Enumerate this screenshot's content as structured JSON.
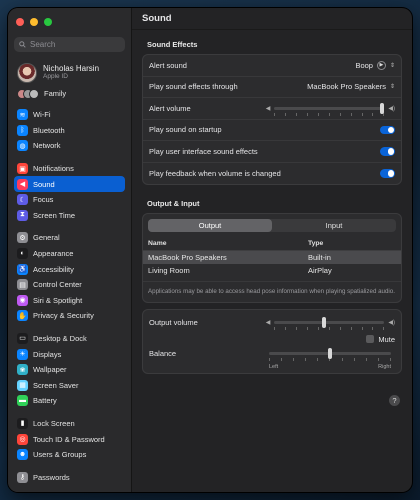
{
  "title": "Sound",
  "search": {
    "placeholder": "Search"
  },
  "account": {
    "name": "Nicholas Harsin",
    "sub": "Apple ID"
  },
  "family": {
    "label": "Family"
  },
  "sidebar": {
    "groups": [
      [
        {
          "label": "Wi-Fi",
          "icon": "wifi-icon",
          "color": "#0a84ff",
          "glyph": "≋"
        },
        {
          "label": "Bluetooth",
          "icon": "bluetooth-icon",
          "color": "#0a84ff",
          "glyph": "ᛒ"
        },
        {
          "label": "Network",
          "icon": "globe-icon",
          "color": "#0a84ff",
          "glyph": "◍"
        }
      ],
      [
        {
          "label": "Notifications",
          "icon": "bell-icon",
          "color": "#ff453a",
          "glyph": "▣"
        },
        {
          "label": "Sound",
          "icon": "speaker-icon",
          "color": "#ff3b5c",
          "glyph": "◀",
          "active": true
        },
        {
          "label": "Focus",
          "icon": "moon-icon",
          "color": "#5e5ce6",
          "glyph": "☾"
        },
        {
          "label": "Screen Time",
          "icon": "hourglass-icon",
          "color": "#5e5ce6",
          "glyph": "⧗"
        }
      ],
      [
        {
          "label": "General",
          "icon": "gear-icon",
          "color": "#8e8e93",
          "glyph": "⚙"
        },
        {
          "label": "Appearance",
          "icon": "appearance-icon",
          "color": "#1c1c1e",
          "glyph": "◐"
        },
        {
          "label": "Accessibility",
          "icon": "accessibility-icon",
          "color": "#0a84ff",
          "glyph": "♿"
        },
        {
          "label": "Control Center",
          "icon": "control-center-icon",
          "color": "#8e8e93",
          "glyph": "▤"
        },
        {
          "label": "Siri & Spotlight",
          "icon": "siri-icon",
          "color": "#bf5af2",
          "glyph": "◉"
        },
        {
          "label": "Privacy & Security",
          "icon": "hand-icon",
          "color": "#0a84ff",
          "glyph": "✋"
        }
      ],
      [
        {
          "label": "Desktop & Dock",
          "icon": "dock-icon",
          "color": "#1c1c1e",
          "glyph": "▭"
        },
        {
          "label": "Displays",
          "icon": "display-icon",
          "color": "#0a84ff",
          "glyph": "☀"
        },
        {
          "label": "Wallpaper",
          "icon": "wallpaper-icon",
          "color": "#30b0c7",
          "glyph": "❀"
        },
        {
          "label": "Screen Saver",
          "icon": "screensaver-icon",
          "color": "#64d2ff",
          "glyph": "▦"
        },
        {
          "label": "Battery",
          "icon": "battery-icon",
          "color": "#30d158",
          "glyph": "▬"
        }
      ],
      [
        {
          "label": "Lock Screen",
          "icon": "lock-icon",
          "color": "#1c1c1e",
          "glyph": "▮"
        },
        {
          "label": "Touch ID & Password",
          "icon": "fingerprint-icon",
          "color": "#ff453a",
          "glyph": "◎"
        },
        {
          "label": "Users & Groups",
          "icon": "users-icon",
          "color": "#0a84ff",
          "glyph": "☻"
        }
      ],
      [
        {
          "label": "Passwords",
          "icon": "key-icon",
          "color": "#8e8e93",
          "glyph": "⚷"
        }
      ]
    ]
  },
  "sound_effects": {
    "heading": "Sound Effects",
    "alert_sound_label": "Alert sound",
    "alert_sound_value": "Boop",
    "play_through_label": "Play sound effects through",
    "play_through_value": "MacBook Pro Speakers",
    "alert_volume_label": "Alert volume",
    "alert_volume_level": 1.0,
    "startup_label": "Play sound on startup",
    "ui_sounds_label": "Play user interface sound effects",
    "feedback_label": "Play feedback when volume is changed"
  },
  "output_input": {
    "heading": "Output & Input",
    "tabs": [
      "Output",
      "Input"
    ],
    "columns": [
      "Name",
      "Type"
    ],
    "devices": [
      {
        "name": "MacBook Pro Speakers",
        "type": "Built-in",
        "selected": true
      },
      {
        "name": "Living Room",
        "type": "AirPlay",
        "selected": false
      }
    ],
    "note": "Applications may be able to access head pose information when playing spatialized audio."
  },
  "output_volume": {
    "label": "Output volume",
    "level": 0.45,
    "mute_label": "Mute",
    "balance_label": "Balance",
    "balance_level": 0.5,
    "left_label": "Left",
    "right_label": "Right"
  },
  "help": "?"
}
